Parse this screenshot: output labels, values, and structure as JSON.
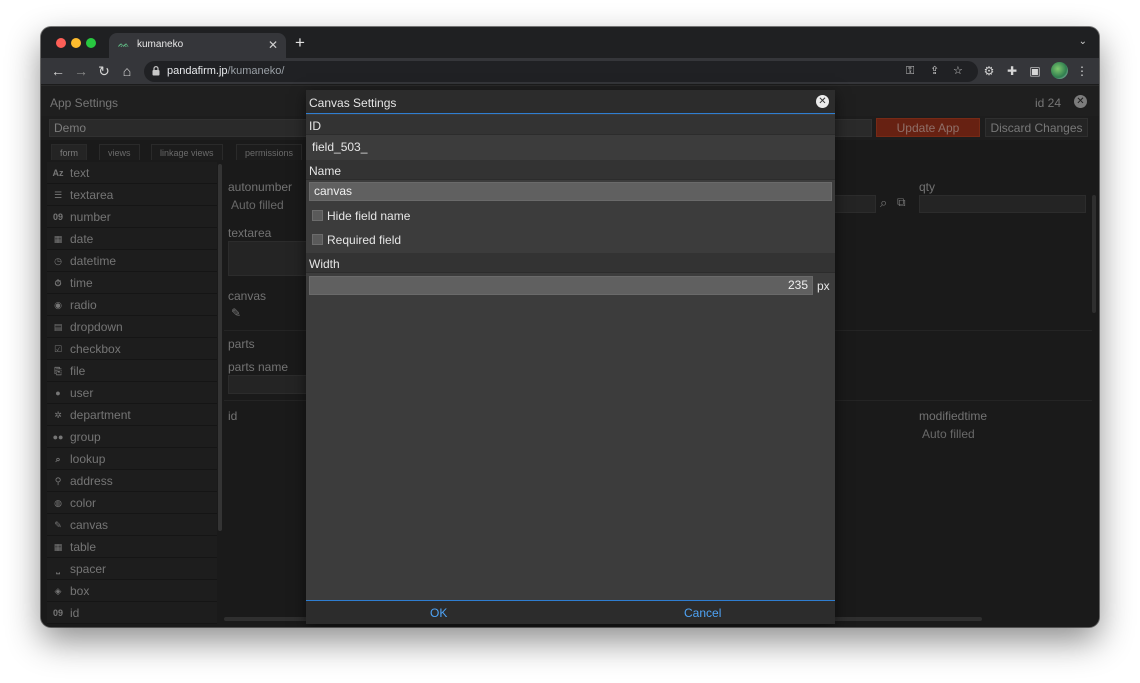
{
  "browser": {
    "tab_title": "kumaneko",
    "url_host": "pandafirm.jp",
    "url_path": "/kumaneko/"
  },
  "app": {
    "title": "App Settings",
    "id_label": "id 24",
    "app_name": "Demo",
    "update_label": "Update App",
    "discard_label": "Discard Changes",
    "tabs": [
      "form",
      "views",
      "linkage views",
      "permissions"
    ]
  },
  "palette": {
    "items": [
      {
        "icon": "Az",
        "label": "text"
      },
      {
        "icon": "☰",
        "label": "textarea"
      },
      {
        "icon": "09",
        "label": "number"
      },
      {
        "icon": "▦",
        "label": "date"
      },
      {
        "icon": "◷",
        "label": "datetime"
      },
      {
        "icon": "⏱",
        "label": "time"
      },
      {
        "icon": "◉",
        "label": "radio"
      },
      {
        "icon": "▤",
        "label": "dropdown"
      },
      {
        "icon": "☑",
        "label": "checkbox"
      },
      {
        "icon": "⎘",
        "label": "file"
      },
      {
        "icon": "●",
        "label": "user"
      },
      {
        "icon": "✲",
        "label": "department"
      },
      {
        "icon": "●●",
        "label": "group"
      },
      {
        "icon": "⌕",
        "label": "lookup"
      },
      {
        "icon": "⚲",
        "label": "address"
      },
      {
        "icon": "◍",
        "label": "color"
      },
      {
        "icon": "✎",
        "label": "canvas"
      },
      {
        "icon": "▦",
        "label": "table"
      },
      {
        "icon": "⎵",
        "label": "spacer"
      },
      {
        "icon": "◈",
        "label": "box"
      },
      {
        "icon": "09",
        "label": "id"
      }
    ]
  },
  "form": {
    "autonumber_label": "autonumber",
    "autonumber_value": "Auto filled",
    "textarea_label": "textarea",
    "canvas_label": "canvas",
    "parts_label": "parts",
    "parts_name_label": "parts name",
    "id_label": "id",
    "qty_label": "qty",
    "modifiedtime_label": "modifiedtime",
    "modifiedtime_value": "Auto filled"
  },
  "dialog": {
    "title": "Canvas Settings",
    "id_section": "ID",
    "id_value": "field_503_",
    "name_section": "Name",
    "name_value": "canvas",
    "hide_field_name_label": "Hide field name",
    "required_field_label": "Required field",
    "width_section": "Width",
    "width_value": "235",
    "width_unit": "px",
    "ok_label": "OK",
    "cancel_label": "Cancel"
  },
  "colors": {
    "accent": "#2f7ed1",
    "button_text": "#4ea3f5",
    "update_button": "#a6361d"
  }
}
